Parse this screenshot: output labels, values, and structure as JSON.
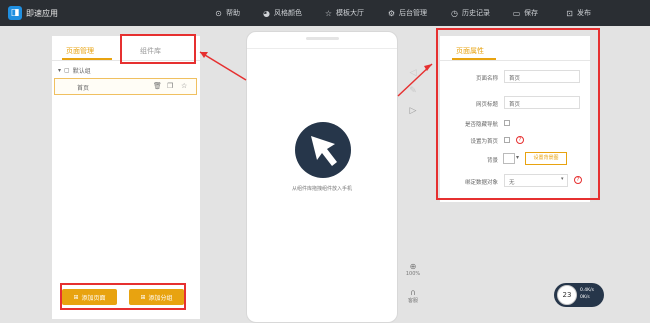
{
  "topbar": {
    "logo_glyph": "◨",
    "title": "即速应用",
    "nav": [
      {
        "icon": "help-icon",
        "glyph": "⊙",
        "label": "帮助"
      },
      {
        "icon": "palette-icon",
        "glyph": "◕",
        "label": "风格颜色"
      },
      {
        "icon": "star-icon",
        "glyph": "☆",
        "label": "模板大厅"
      },
      {
        "icon": "gear-icon",
        "glyph": "⚙",
        "label": "后台管理"
      },
      {
        "icon": "history-icon",
        "glyph": "◷",
        "label": "历史记录"
      },
      {
        "icon": "save-icon",
        "glyph": "▭",
        "label": "保存"
      },
      {
        "icon": "publish-icon",
        "glyph": "⊡",
        "label": "发布"
      }
    ]
  },
  "left_panel": {
    "tab_pages": "页面管理",
    "tab_components": "组件库",
    "tree_root": "默认组",
    "page_item": "首页",
    "add_page": "添加页面",
    "add_category": "添加分组"
  },
  "phone": {
    "drop_hint": "从组件库拖拽组件放入手机"
  },
  "side_tools": {
    "zoom_label": "100%",
    "help_label": "客服"
  },
  "properties": {
    "title": "页面属性",
    "page_name_label": "页面名称",
    "page_name_value": "首页",
    "page_title_label": "网页标题",
    "page_title_value": "首页",
    "hide_nav_label": "是否隐藏导航",
    "set_home_label": "设置为首页",
    "background_label": "背景",
    "set_background_button": "设置背景图",
    "carousel_label": "绑定数据对象",
    "carousel_value": "无"
  },
  "floating": {
    "badge": "23",
    "line1": "0.4K/s",
    "line2": "0K/s"
  },
  "colors": {
    "accent": "#e8a310",
    "topbar": "#2a2e33",
    "callout": "#e63030",
    "dark_circle": "#26364a"
  }
}
